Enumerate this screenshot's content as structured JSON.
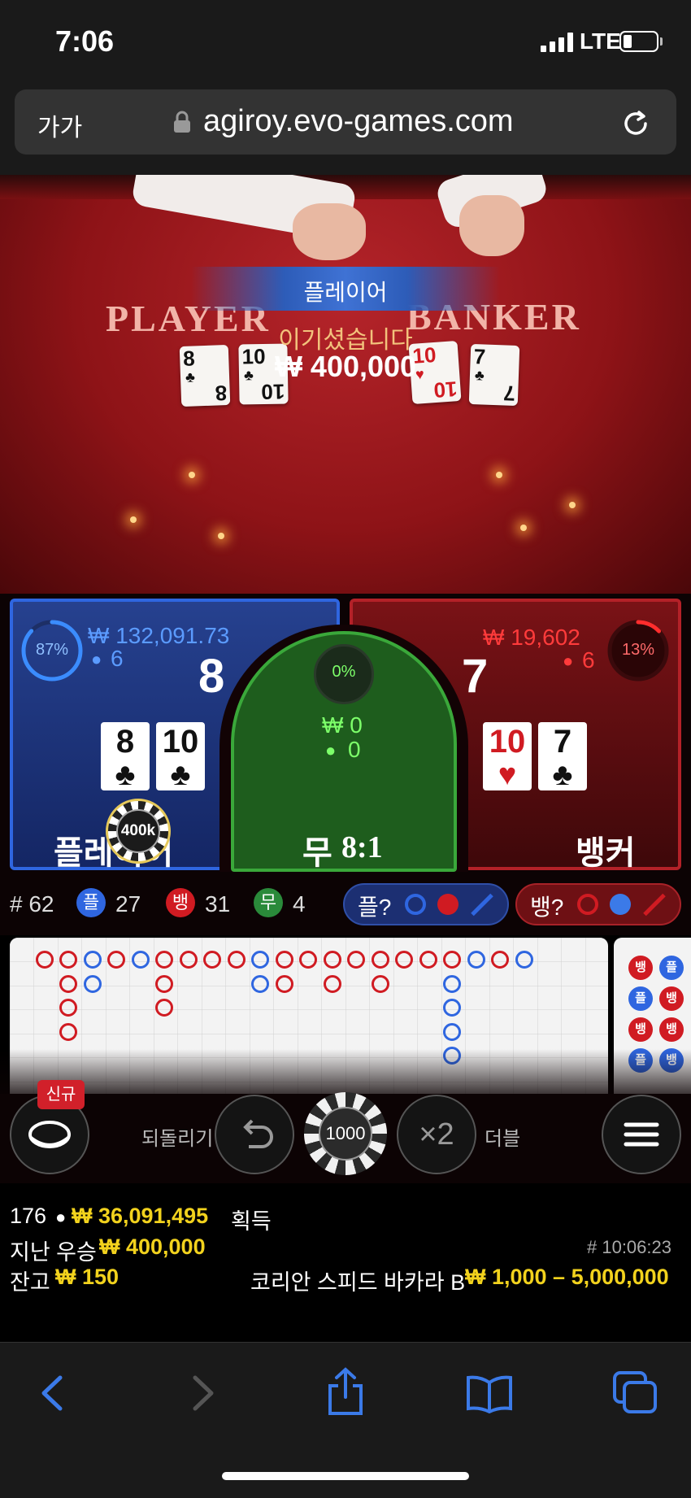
{
  "status": {
    "time": "7:06",
    "network": "LTE"
  },
  "browser": {
    "text_size_label": "가가",
    "url": "agiroy.evo-games.com",
    "lock_icon": "lock-icon",
    "reload_icon": "reload-icon"
  },
  "video": {
    "player_title": "PLAYER",
    "banker_title": "BANKER",
    "player_cards": [
      {
        "rank": "8",
        "suit": "♣"
      },
      {
        "rank": "10",
        "suit": "♣"
      }
    ],
    "banker_cards": [
      {
        "rank": "10",
        "suit": "♥"
      },
      {
        "rank": "7",
        "suit": "♣"
      }
    ],
    "winner_side": "플레이어",
    "win_message": "이기셨습니다",
    "win_amount": "₩ 400,000"
  },
  "bets": {
    "player": {
      "percent": "87%",
      "percent_value": 87,
      "amount": "₩ 132,091.73",
      "count": "6",
      "score": "8",
      "label": "플레이어",
      "cards": [
        {
          "rank": "8",
          "suit": "♣"
        },
        {
          "rank": "10",
          "suit": "♣"
        }
      ]
    },
    "tie": {
      "percent": "0%",
      "amount": "₩ 0",
      "count": "0",
      "label": "무",
      "payout": "8:1"
    },
    "banker": {
      "percent": "13%",
      "percent_value": 13,
      "amount": "₩ 19,602",
      "count": "6",
      "score": "7",
      "label": "뱅커",
      "cards": [
        {
          "rank": "10",
          "suit": "♥"
        },
        {
          "rank": "7",
          "suit": "♣"
        }
      ]
    },
    "placed_chip": "400k"
  },
  "stats": {
    "round_label": "# 62",
    "player_short": "플",
    "player_count": "27",
    "banker_short": "뱅",
    "banker_count": "31",
    "tie_short": "무",
    "tie_count": "4",
    "player_ask": "플?",
    "banker_ask": "뱅?"
  },
  "road": {
    "big_road": [
      [
        "R",
        "R",
        "B",
        "R",
        "B",
        "R",
        "R",
        "R",
        "R",
        "B",
        "R",
        "R",
        "R",
        "R",
        "R",
        "R",
        "R",
        "R",
        "B",
        "R",
        "B"
      ],
      [],
      [],
      [],
      []
    ],
    "side_beads": [
      "뱅",
      "플",
      "뱅",
      "플"
    ],
    "side_beads2": [
      "플",
      "뱅",
      "뱅",
      "뱅"
    ]
  },
  "controls": {
    "new_badge": "신규",
    "undo_label": "되돌리기",
    "chip_value": "1000",
    "double_label": "더블",
    "double_symbol": "×2"
  },
  "info": {
    "players_online": "176",
    "total_won": "₩ 36,091,495",
    "won_suffix": "획득",
    "last_win_label": "지난 우승",
    "last_win_amount": "₩ 400,000",
    "round_id": "# 10:06:23",
    "balance_label": "잔고",
    "balance_amount": "₩ 150",
    "table_name": "코리안 스피드 바카라 B",
    "limits": "₩ 1,000 – 5,000,000"
  },
  "colors": {
    "player": "#2f66e0",
    "banker": "#d01b22",
    "tie": "#3aa83a",
    "gold": "#f2d21d"
  }
}
